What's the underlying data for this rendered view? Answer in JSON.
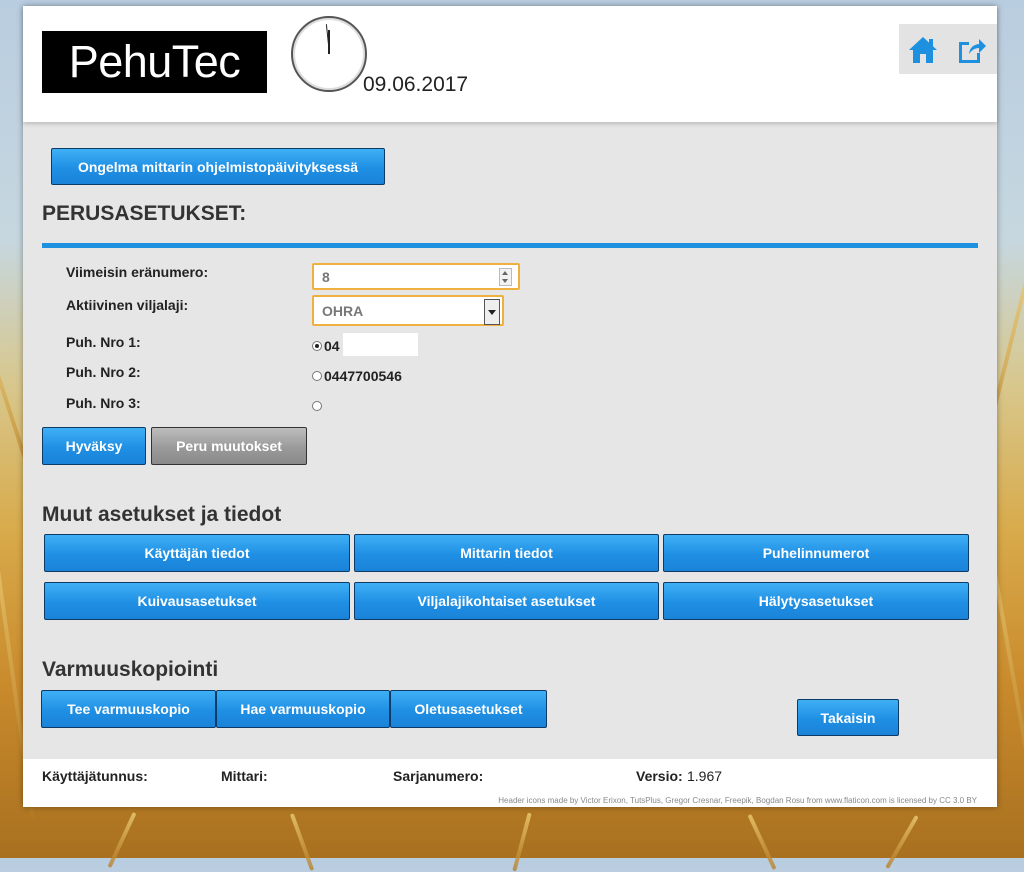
{
  "header": {
    "logo_text": "PehuTec",
    "date": "09.06.2017",
    "icons": [
      "home-icon",
      "share-icon"
    ]
  },
  "alert_button": "Ongelma mittarin ohjelmistopäivityksessä",
  "basic": {
    "title": "PERUSASETUKSET:",
    "batch_label": "Viimeisin eränumero:",
    "batch_value": "8",
    "crop_label": "Aktiivinen viljalaji:",
    "crop_value": "OHRA",
    "phone1_label": "Puh. Nro 1:",
    "phone1_value": "04",
    "phone2_label": "Puh. Nro 2:",
    "phone2_value": "0447700546",
    "phone3_label": "Puh. Nro 3:",
    "phone3_value": "",
    "selected_phone": 1,
    "accept_button": "Hyväksy",
    "cancel_button": "Peru muutokset"
  },
  "other": {
    "title": "Muut asetukset ja tiedot",
    "buttons": [
      "Käyttäjän tiedot",
      "Mittarin tiedot",
      "Puhelinnumerot",
      "Kuivausasetukset",
      "Viljalajikohtaiset asetukset",
      "Hälytysasetukset"
    ]
  },
  "backup": {
    "title": "Varmuuskopiointi",
    "make_button": "Tee varmuuskopio",
    "fetch_button": "Hae varmuuskopio",
    "defaults_button": "Oletusasetukset",
    "back_button": "Takaisin"
  },
  "footer": {
    "user_label": "Käyttäjätunnus:",
    "meter_label": "Mittari:",
    "serial_label": "Sarjanumero:",
    "version_label": "Versio:",
    "version_value": "1.967",
    "credits": "Header icons made by Victor Erixon, TutsPlus, Gregor Cresnar, Freepik, Bogdan Rosu from www.flaticon.com is licensed by CC 3.0 BY"
  },
  "colors": {
    "accent": "#1e90e0",
    "field_border": "#f0b040"
  }
}
